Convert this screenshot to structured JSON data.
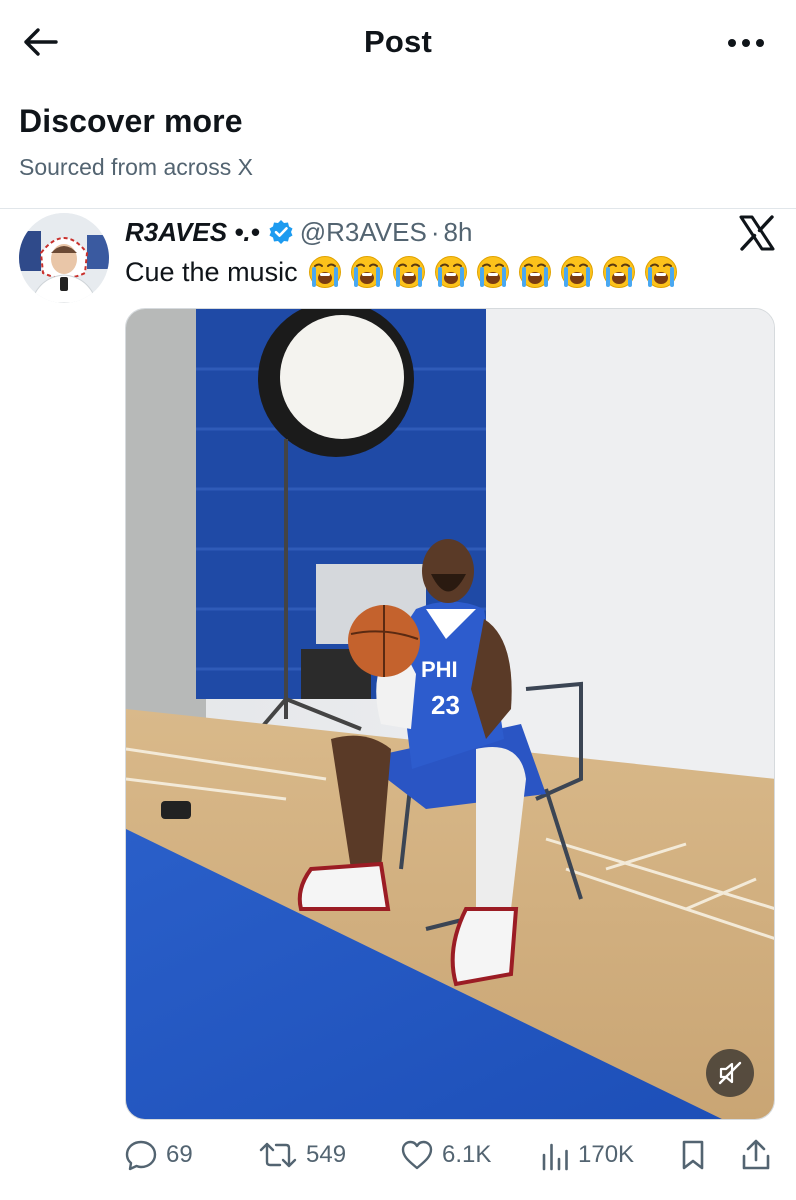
{
  "header": {
    "title": "Post",
    "back_icon": "arrow-left-icon",
    "more_icon": "more-horizontal-icon"
  },
  "discover": {
    "title": "Discover more",
    "subtitle": "Sourced from across X"
  },
  "tweet": {
    "author_name": "R3AVES •.•",
    "handle": "@R3AVES",
    "separator": "·",
    "time": "8h",
    "text": "Cue the music",
    "emoji_name": "loudly-crying-face",
    "emoji_count": 9,
    "verified_color": "#1d9bf0",
    "brand_icon": "x-logo-icon"
  },
  "media": {
    "type": "video",
    "muted": true,
    "mute_icon": "speaker-muted-icon"
  },
  "actions": {
    "replies": "69",
    "reposts": "549",
    "likes": "6.1K",
    "views": "170K",
    "reply_icon": "reply-icon",
    "repost_icon": "repost-icon",
    "like_icon": "heart-icon",
    "views_icon": "views-icon",
    "bookmark_icon": "bookmark-icon",
    "share_icon": "share-icon"
  },
  "colors": {
    "text": "#0f1419",
    "secondary": "#536471",
    "accent": "#1d9bf0",
    "divider": "#e1e6ea"
  }
}
